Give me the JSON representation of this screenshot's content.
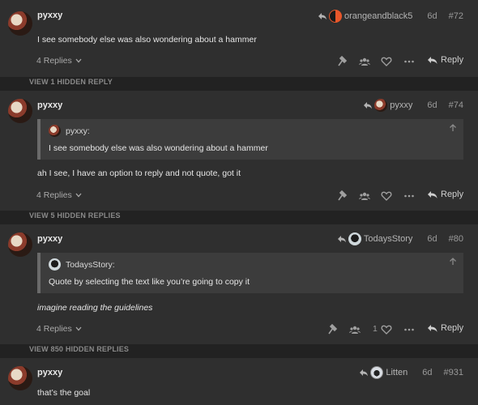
{
  "colors": {
    "page_bg": "#222222",
    "post_bg": "#2f2f2f",
    "quote_bg": "#3c3c3c",
    "text": "#e6e6e6",
    "muted": "#9a9a9a"
  },
  "posts": [
    {
      "username": "pyxxy",
      "reply_to": "orangeandblack5",
      "age": "6d",
      "number": "#72",
      "text": "I see somebody else was also wondering about a hammer",
      "replies": "4 Replies",
      "reply_label": "Reply"
    },
    {
      "username": "pyxxy",
      "reply_to": "pyxxy",
      "age": "6d",
      "number": "#74",
      "quote_author": "pyxxy:",
      "quote_text": "I see somebody else was also wondering about a hammer",
      "text": "ah I see, I have an option to reply and not quote, got it",
      "replies": "4 Replies",
      "reply_label": "Reply"
    },
    {
      "username": "pyxxy",
      "reply_to": "TodaysStory",
      "age": "6d",
      "number": "#80",
      "quote_author": "TodaysStory:",
      "quote_text": "Quote by selecting the text like you’re going to copy it",
      "text": "imagine reading the guidelines",
      "replies": "4 Replies",
      "like_count": "1",
      "reply_label": "Reply"
    },
    {
      "username": "pyxxy",
      "reply_to": "Litten",
      "age": "6d",
      "number": "#931",
      "text": "that’s the goal"
    }
  ],
  "hidden_strips": [
    "VIEW 1 HIDDEN REPLY",
    "VIEW 5 HIDDEN REPLIES",
    "VIEW 850 HIDDEN REPLIES"
  ],
  "icons": [
    "reply-arrow-icon",
    "flag-icon",
    "users-icon",
    "heart-icon",
    "ellipsis-icon",
    "reply-icon",
    "arrow-up-icon",
    "chevron-down-icon"
  ]
}
